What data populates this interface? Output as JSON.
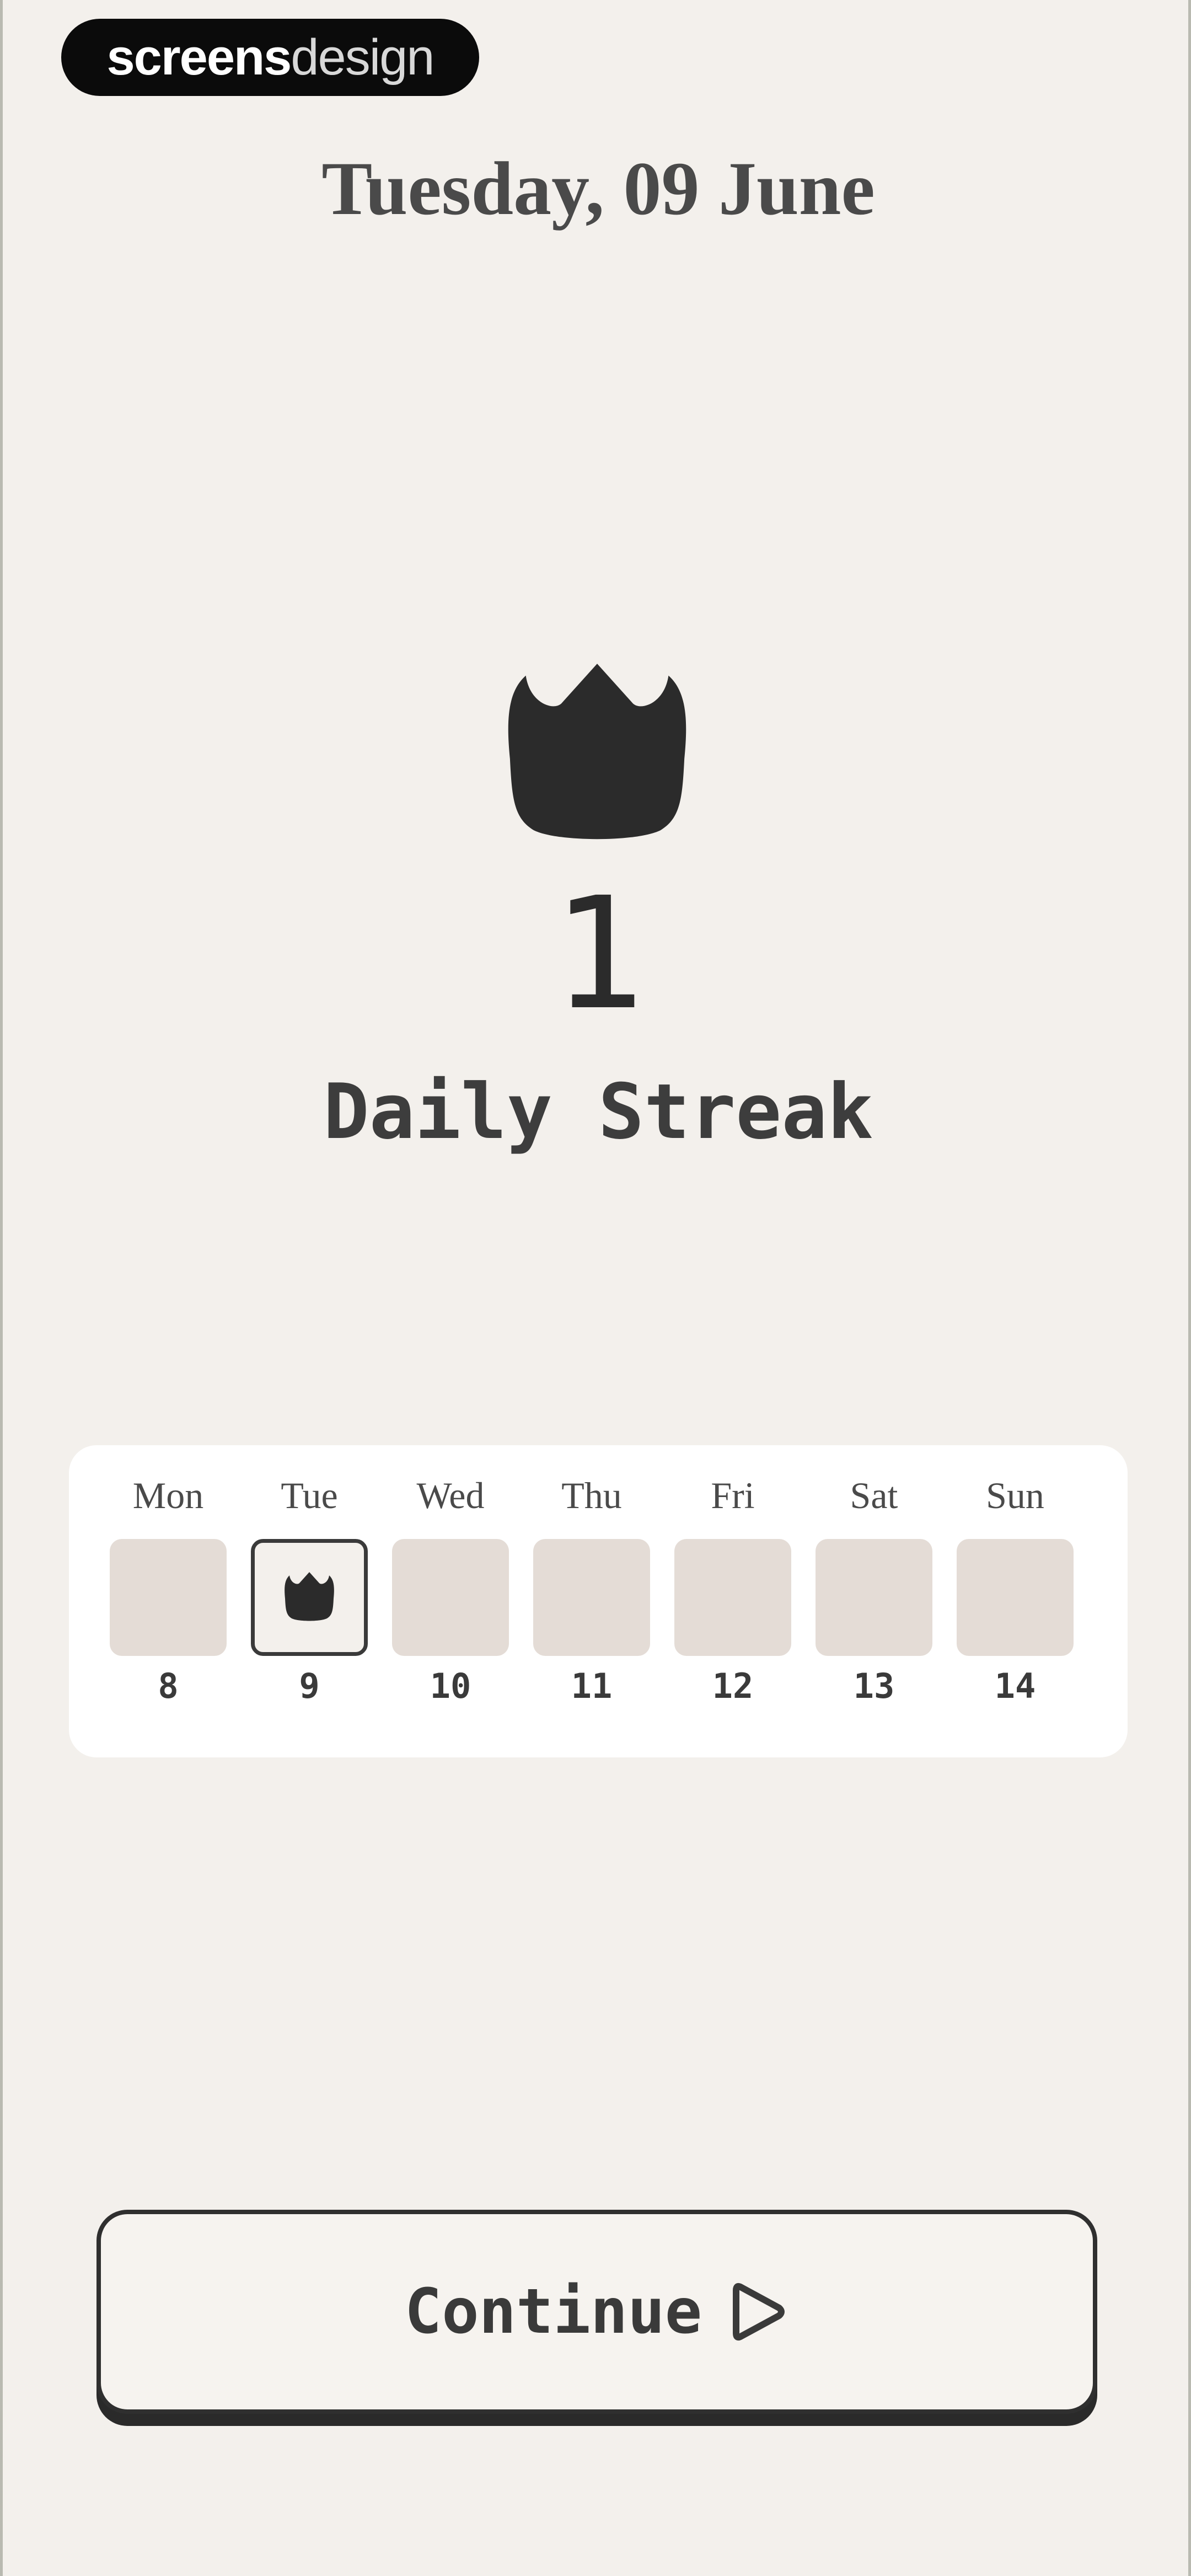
{
  "watermark": {
    "brand_bold": "screens",
    "brand_light": "design"
  },
  "header": {
    "date": "Tuesday, 09 June"
  },
  "streak": {
    "icon": "crown-icon",
    "count": "1",
    "label": "Daily Streak"
  },
  "week": {
    "days": [
      {
        "name": "Mon",
        "date": "8",
        "completed": false
      },
      {
        "name": "Tue",
        "date": "9",
        "completed": true
      },
      {
        "name": "Wed",
        "date": "10",
        "completed": false
      },
      {
        "name": "Thu",
        "date": "11",
        "completed": false
      },
      {
        "name": "Fri",
        "date": "12",
        "completed": false
      },
      {
        "name": "Sat",
        "date": "13",
        "completed": false
      },
      {
        "name": "Sun",
        "date": "14",
        "completed": false
      }
    ]
  },
  "footer": {
    "continue_label": "Continue",
    "continue_icon": "play-icon"
  },
  "colors": {
    "background": "#f3f0ec",
    "ink": "#2b2b2b",
    "empty_day": "#e4dcd6",
    "card": "#ffffff"
  }
}
